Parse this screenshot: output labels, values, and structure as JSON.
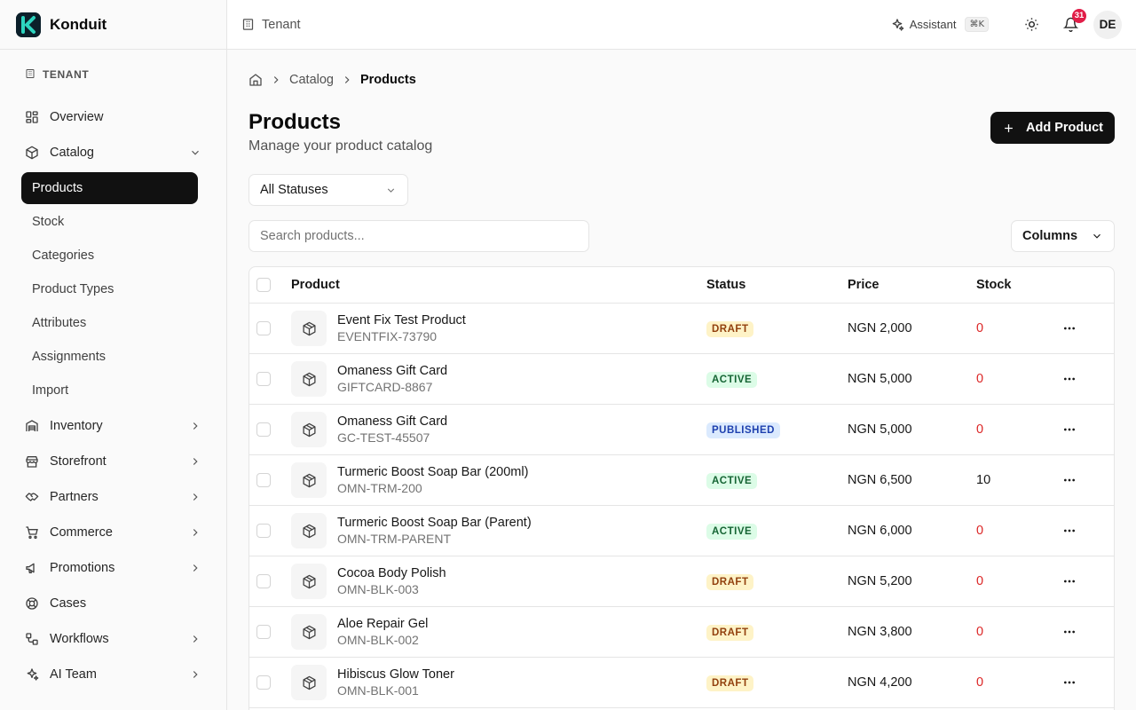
{
  "brand": {
    "name": "Konduit"
  },
  "sidebar": {
    "section_label": "TENANT",
    "items": [
      {
        "label": "Overview",
        "icon": "grid-icon",
        "chevron": false
      },
      {
        "label": "Catalog",
        "icon": "box-icon",
        "chevron": "down"
      }
    ],
    "catalog_sub": [
      "Products",
      "Stock",
      "Categories",
      "Product Types",
      "Attributes",
      "Assignments",
      "Import"
    ],
    "items_after": [
      {
        "label": "Inventory",
        "icon": "warehouse-icon"
      },
      {
        "label": "Storefront",
        "icon": "store-icon"
      },
      {
        "label": "Partners",
        "icon": "handshake-icon"
      },
      {
        "label": "Commerce",
        "icon": "cart-icon"
      },
      {
        "label": "Promotions",
        "icon": "megaphone-icon"
      },
      {
        "label": "Cases",
        "icon": "lifebuoy-icon"
      },
      {
        "label": "Workflows",
        "icon": "workflow-icon"
      },
      {
        "label": "AI Team",
        "icon": "sparkles-icon"
      }
    ]
  },
  "topbar": {
    "tenant": "Tenant",
    "assistant": "Assistant",
    "shortcut": "⌘K",
    "notifications": "31",
    "avatar": "DE"
  },
  "breadcrumb": [
    "Catalog",
    "Products"
  ],
  "page": {
    "title": "Products",
    "subtitle": "Manage your product catalog",
    "add_label": "Add Product",
    "filter": "All Statuses",
    "search_placeholder": "Search products...",
    "columns_label": "Columns"
  },
  "table": {
    "headers": {
      "product": "Product",
      "status": "Status",
      "price": "Price",
      "stock": "Stock"
    },
    "rows": [
      {
        "name": "Event Fix Test Product",
        "sku": "EVENTFIX-73790",
        "status": "DRAFT",
        "price": "NGN 2,000",
        "stock": "0"
      },
      {
        "name": "Omaness Gift Card",
        "sku": "GIFTCARD-8867",
        "status": "ACTIVE",
        "price": "NGN 5,000",
        "stock": "0"
      },
      {
        "name": "Omaness Gift Card",
        "sku": "GC-TEST-45507",
        "status": "PUBLISHED",
        "price": "NGN 5,000",
        "stock": "0"
      },
      {
        "name": "Turmeric Boost Soap Bar (200ml)",
        "sku": "OMN-TRM-200",
        "status": "ACTIVE",
        "price": "NGN 6,500",
        "stock": "10"
      },
      {
        "name": "Turmeric Boost Soap Bar (Parent)",
        "sku": "OMN-TRM-PARENT",
        "status": "ACTIVE",
        "price": "NGN 6,000",
        "stock": "0"
      },
      {
        "name": "Cocoa Body Polish",
        "sku": "OMN-BLK-003",
        "status": "DRAFT",
        "price": "NGN 5,200",
        "stock": "0"
      },
      {
        "name": "Aloe Repair Gel",
        "sku": "OMN-BLK-002",
        "status": "DRAFT",
        "price": "NGN 3,800",
        "stock": "0"
      },
      {
        "name": "Hibiscus Glow Toner",
        "sku": "OMN-BLK-001",
        "status": "DRAFT",
        "price": "NGN 4,200",
        "stock": "0"
      }
    ]
  },
  "colors": {
    "primary": "#111111",
    "danger": "#dc2626",
    "brand_accent": "#2dd4bf"
  }
}
